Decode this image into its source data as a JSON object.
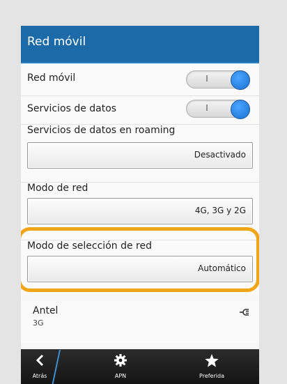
{
  "title": "Red móvil",
  "rows": {
    "mobile_network": {
      "label": "Red móvil",
      "toggle_text": "I",
      "enabled": true
    },
    "data_services": {
      "label": "Servicios de datos",
      "toggle_text": "I",
      "enabled": true
    },
    "roaming": {
      "label": "Servicios de datos en roaming",
      "value": "Desactivado"
    },
    "network_mode": {
      "label": "Modo de red",
      "value": "4G, 3G y 2G"
    },
    "selection_mode": {
      "label": "Modo de selección de red",
      "value": "Automático"
    }
  },
  "network": {
    "name": "Antel",
    "type": "3G",
    "icon": "connected-plug-icon"
  },
  "bottombar": {
    "back_label": "Atrás",
    "apn_label": "APN",
    "preferred_label": "Preferida"
  },
  "colors": {
    "titlebar": "#1d6aa8",
    "highlight": "#f2a516",
    "toggle_on": "#1a6fd0"
  }
}
